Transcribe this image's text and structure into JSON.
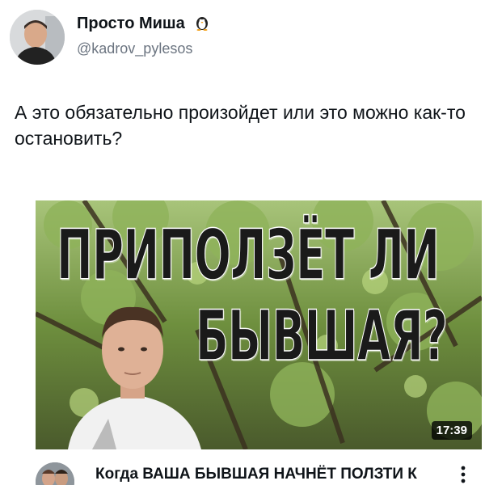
{
  "user": {
    "display_name": "Просто Миша",
    "handle": "@kadrov_pylesos"
  },
  "tweet": {
    "text": "А это обязательно произойдет или это можно как-то остановить?"
  },
  "video": {
    "thumbnail_line1": "ПРИПОЛЗЁТ ЛИ",
    "thumbnail_line2": "БЫВШАЯ?",
    "duration": "17:39",
    "title": "Когда ВАША БЫВШАЯ НАЧНЁТ ПОЛЗТИ К"
  },
  "icons": {
    "badge": "penguin-badge-icon",
    "more": "more-vertical-icon"
  },
  "colors": {
    "handle": "#6b7480",
    "text": "#0f1419"
  }
}
